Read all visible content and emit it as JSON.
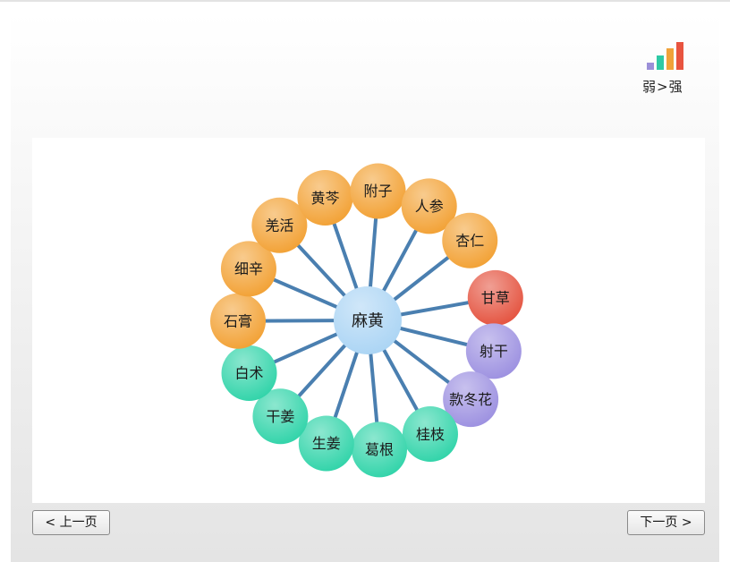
{
  "legend": {
    "label": "弱>强",
    "bar_colors": [
      "#9b8fd8",
      "#2ec9a5",
      "#f0a23a",
      "#e8543f"
    ]
  },
  "diagram": {
    "center": {
      "label": "麻黄"
    },
    "nodes": [
      {
        "label": "甘草",
        "strength": "very-strong"
      },
      {
        "label": "射干",
        "strength": "weak"
      },
      {
        "label": "款冬花",
        "strength": "weak"
      },
      {
        "label": "桂枝",
        "strength": "medium"
      },
      {
        "label": "葛根",
        "strength": "medium"
      },
      {
        "label": "生姜",
        "strength": "medium"
      },
      {
        "label": "干姜",
        "strength": "medium"
      },
      {
        "label": "白术",
        "strength": "medium"
      },
      {
        "label": "石膏",
        "strength": "strong"
      },
      {
        "label": "细辛",
        "strength": "strong"
      },
      {
        "label": "羌活",
        "strength": "strong"
      },
      {
        "label": "黄芩",
        "strength": "strong"
      },
      {
        "label": "附子",
        "strength": "strong"
      },
      {
        "label": "人参",
        "strength": "strong"
      },
      {
        "label": "杏仁",
        "strength": "strong"
      }
    ],
    "colors": {
      "weak": "#9b8fe0",
      "medium": "#2ed3a8",
      "strong": "#f2a032",
      "very-strong": "#e4513d",
      "center": "#aad4f4",
      "edge": "#4a7fb0"
    }
  },
  "nav": {
    "prev_label": "< 上一页",
    "next_label": "下一页 >"
  }
}
